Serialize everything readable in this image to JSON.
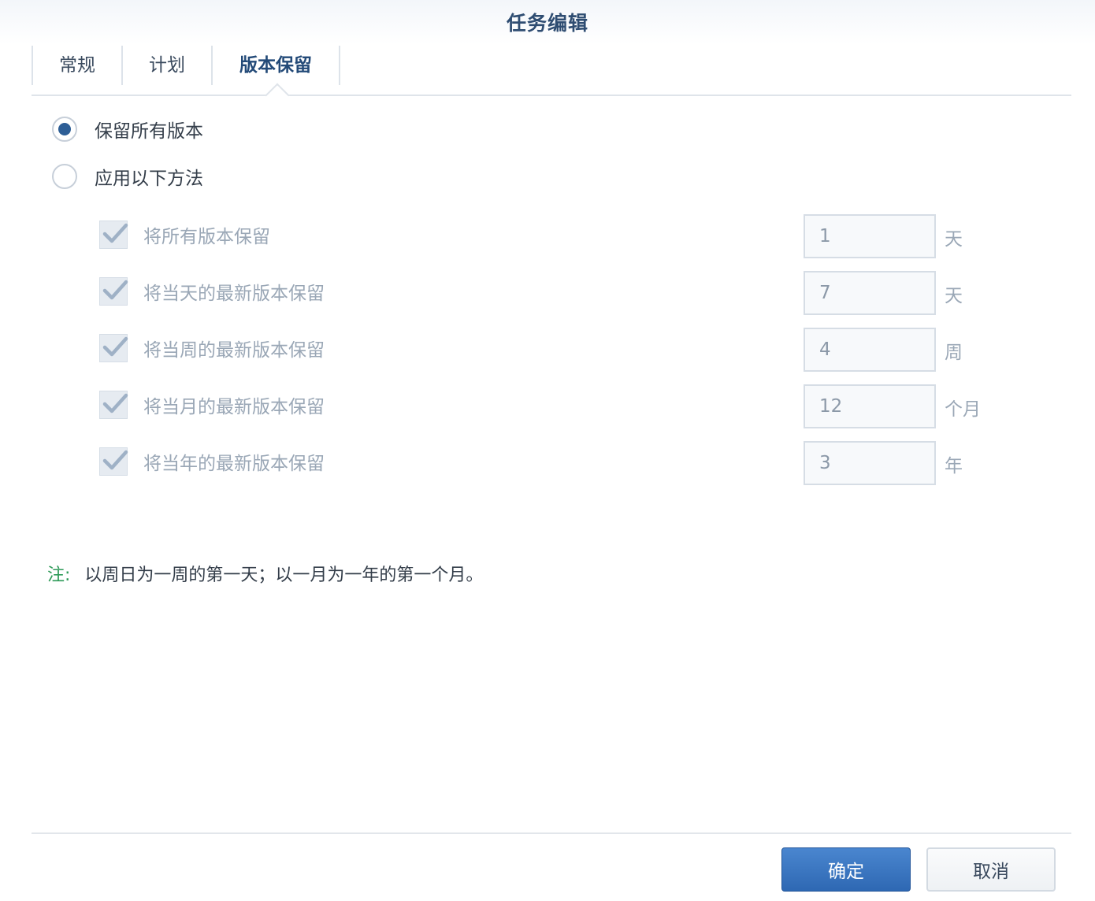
{
  "dialog": {
    "title": "任务编辑"
  },
  "tabs": [
    {
      "label": "常规"
    },
    {
      "label": "计划"
    },
    {
      "label": "版本保留",
      "active": true
    }
  ],
  "retention_mode": {
    "selected": "keep_all",
    "options": [
      {
        "id": "keep_all",
        "label": "保留所有版本",
        "checked": true
      },
      {
        "id": "apply_rules",
        "label": "应用以下方法",
        "checked": false
      }
    ]
  },
  "rules": [
    {
      "label": "将所有版本保留",
      "value": "1",
      "unit": "天",
      "checked": true
    },
    {
      "label": "将当天的最新版本保留",
      "value": "7",
      "unit": "天",
      "checked": true
    },
    {
      "label": "将当周的最新版本保留",
      "value": "4",
      "unit": "周",
      "checked": true
    },
    {
      "label": "将当月的最新版本保留",
      "value": "12",
      "unit": "个月",
      "checked": true
    },
    {
      "label": "将当年的最新版本保留",
      "value": "3",
      "unit": "年",
      "checked": true
    }
  ],
  "note": {
    "label": "注:",
    "text": "以周日为一周的第一天；以一月为一年的第一个月。"
  },
  "footer": {
    "ok_label": "确定",
    "cancel_label": "取消"
  },
  "colors": {
    "accent": "#2d5e96",
    "title": "#2f4d72",
    "note_label": "#2e9a58",
    "disabled_text": "#9aa7b6"
  }
}
